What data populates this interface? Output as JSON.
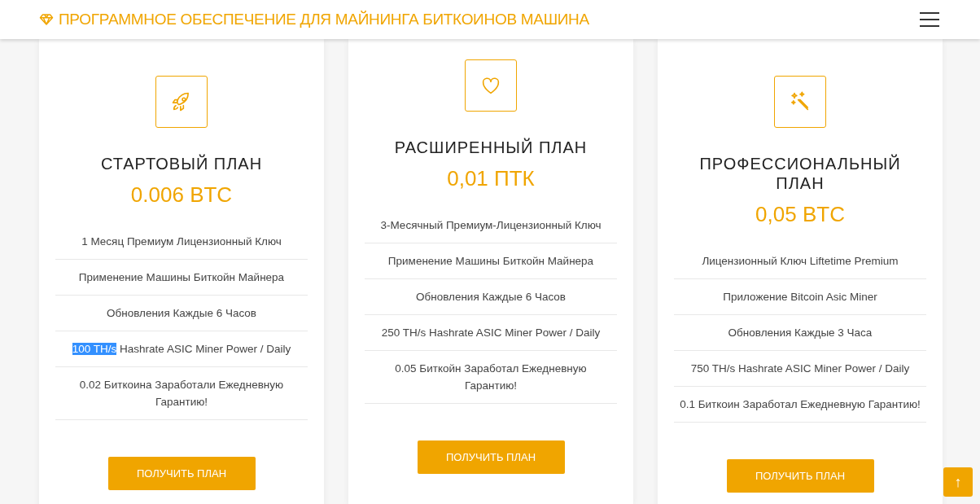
{
  "header": {
    "title": "ПРОГРАММНОЕ ОБЕСПЕЧЕНИЕ ДЛЯ МАЙНИНГА БИТКОИНОВ МАШИНА"
  },
  "plans": [
    {
      "kind": "rocket",
      "featured": false,
      "title": "СТАРТОВЫЙ ПЛАН",
      "price": "0.006 BTC",
      "features": [
        {
          "text": "1 Месяц Премиум Лицензионный Ключ"
        },
        {
          "text": "Применение Машины Биткойн Майнера"
        },
        {
          "text": "Обновления Каждые 6 Часов"
        },
        {
          "parts": [
            {
              "text": "100 TH/s",
              "selected": true
            },
            {
              "text": " Hashrate ASIC Miner Power / Daily",
              "selected": false
            }
          ]
        },
        {
          "text": "0.02 Биткоина Заработали Ежедневную Гарантию!"
        }
      ],
      "button": "ПОЛУЧИТЬ ПЛАН"
    },
    {
      "kind": "heart",
      "featured": true,
      "title": "РАСШИРЕННЫЙ ПЛАН",
      "price": "0,01 ПТК",
      "features": [
        {
          "text": "3-Месячный Премиум-Лицензионный Ключ"
        },
        {
          "text": "Применение Машины Биткойн Майнера"
        },
        {
          "text": "Обновления Каждые 6 Часов"
        },
        {
          "text": "250 TH/s Hashrate ASIC Miner Power / Daily"
        },
        {
          "text": "0.05 Биткойн Заработал Ежедневную Гарантию!"
        }
      ],
      "button": "ПОЛУЧИТЬ ПЛАН"
    },
    {
      "kind": "wand",
      "featured": false,
      "title": "ПРОФЕССИОНАЛЬНЫЙ ПЛАН",
      "price": "0,05 BTC",
      "features": [
        {
          "text": "Лицензионный Ключ Liftetime Premium"
        },
        {
          "text": "Приложение Bitcoin Asic Miner"
        },
        {
          "text": "Обновления Каждые 3 Часа"
        },
        {
          "text": "750 TH/s Hashrate ASIC Miner Power / Daily"
        },
        {
          "text": "0.1 Биткоин Заработал Ежедневную Гарантию!"
        }
      ],
      "button": "ПОЛУЧИТЬ ПЛАН"
    }
  ],
  "scroll_top": "↑"
}
